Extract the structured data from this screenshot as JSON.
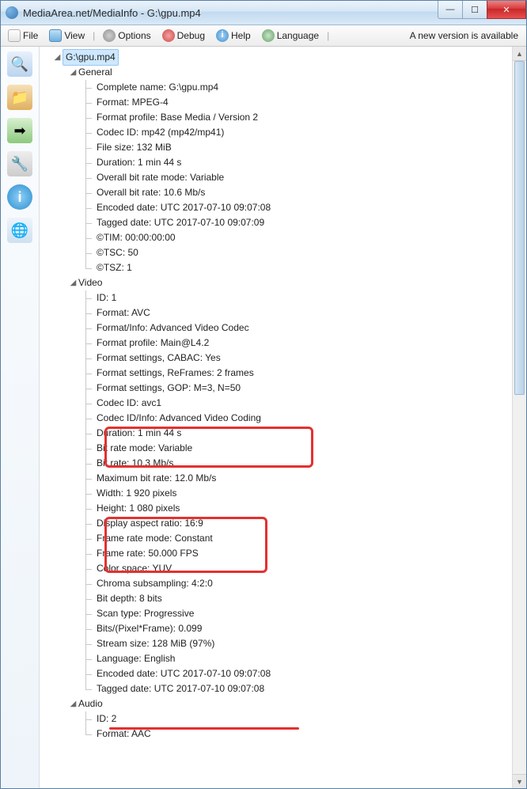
{
  "title": "MediaArea.net/MediaInfo - G:\\gpu.mp4",
  "menu": {
    "file": "File",
    "view": "View",
    "options": "Options",
    "debug": "Debug",
    "help": "Help",
    "language": "Language",
    "update_msg": "A new version is available"
  },
  "tree": {
    "root": "G:\\gpu.mp4",
    "sections": [
      {
        "name": "General",
        "items": [
          "Complete name: G:\\gpu.mp4",
          "Format: MPEG-4",
          "Format profile: Base Media / Version 2",
          "Codec ID: mp42 (mp42/mp41)",
          "File size: 132 MiB",
          "Duration: 1 min 44 s",
          "Overall bit rate mode: Variable",
          "Overall bit rate: 10.6 Mb/s",
          "Encoded date: UTC 2017-07-10 09:07:08",
          "Tagged date: UTC 2017-07-10 09:07:09",
          "©TIM: 00:00:00:00",
          "©TSC: 50",
          "©TSZ: 1"
        ]
      },
      {
        "name": "Video",
        "items": [
          "ID: 1",
          "Format: AVC",
          "Format/Info: Advanced Video Codec",
          "Format profile: Main@L4.2",
          "Format settings, CABAC: Yes",
          "Format settings, ReFrames: 2 frames",
          "Format settings, GOP: M=3, N=50",
          "Codec ID: avc1",
          "Codec ID/Info: Advanced Video Coding",
          "Duration: 1 min 44 s",
          "Bit rate mode: Variable",
          "Bit rate: 10.3 Mb/s",
          "Maximum bit rate: 12.0 Mb/s",
          "Width: 1 920 pixels",
          "Height: 1 080 pixels",
          "Display aspect ratio: 16:9",
          "Frame rate mode: Constant",
          "Frame rate: 50.000 FPS",
          "Color space: YUV",
          "Chroma subsampling: 4:2:0",
          "Bit depth: 8 bits",
          "Scan type: Progressive",
          "Bits/(Pixel*Frame): 0.099",
          "Stream size: 128 MiB (97%)",
          "Language: English",
          "Encoded date: UTC 2017-07-10 09:07:08",
          "Tagged date: UTC 2017-07-10 09:07:08"
        ]
      },
      {
        "name": "Audio",
        "items": [
          "ID: 2",
          "Format: AAC"
        ]
      }
    ]
  },
  "win_controls": {
    "min": "—",
    "max": "☐",
    "close": "✕"
  }
}
